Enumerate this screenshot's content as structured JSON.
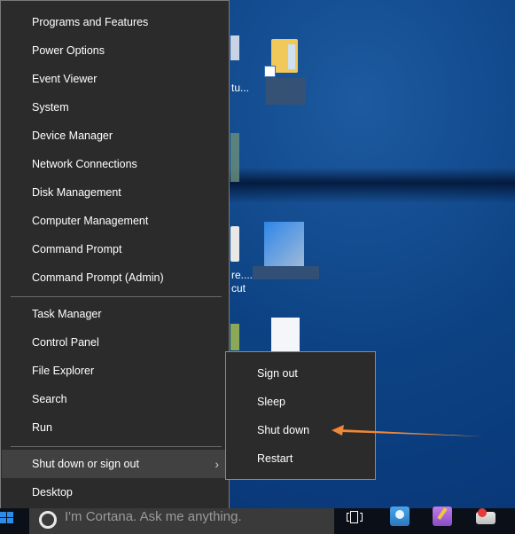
{
  "winx_menu": {
    "groups": [
      {
        "items": [
          {
            "label": "Programs and Features"
          },
          {
            "label": "Power Options"
          },
          {
            "label": "Event Viewer"
          },
          {
            "label": "System"
          },
          {
            "label": "Device Manager"
          },
          {
            "label": "Network Connections"
          },
          {
            "label": "Disk Management"
          },
          {
            "label": "Computer Management"
          },
          {
            "label": "Command Prompt"
          },
          {
            "label": "Command Prompt (Admin)"
          }
        ]
      },
      {
        "items": [
          {
            "label": "Task Manager"
          },
          {
            "label": "Control Panel"
          },
          {
            "label": "File Explorer"
          },
          {
            "label": "Search"
          },
          {
            "label": "Run"
          }
        ]
      },
      {
        "items": [
          {
            "label": "Shut down or sign out",
            "has_submenu": true,
            "highlighted": true,
            "chevron": "›"
          },
          {
            "label": "Desktop"
          }
        ]
      }
    ]
  },
  "submenu": {
    "items": [
      {
        "label": "Sign out"
      },
      {
        "label": "Sleep"
      },
      {
        "label": "Shut down",
        "annotated": true
      },
      {
        "label": "Restart"
      }
    ]
  },
  "annotation": {
    "type": "arrow",
    "color": "#f0883a",
    "points_to": "Shut down"
  },
  "desktop": {
    "fragments": [
      "tu...",
      "re....",
      "cut"
    ]
  },
  "taskbar": {
    "start_icon": "windows-logo-icon",
    "cortana_placeholder": "I'm Cortana. Ask me anything.",
    "apps": [
      "task-view-icon",
      "backup-app-icon",
      "disk-tool-icon",
      "network-app-icon"
    ]
  }
}
